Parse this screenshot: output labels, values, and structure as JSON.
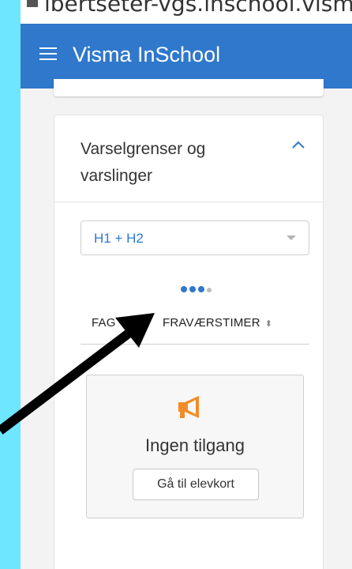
{
  "browser": {
    "url": "ibertseter-vgs.inschool.visma.no"
  },
  "appbar": {
    "title": "Visma InSchool"
  },
  "card": {
    "title": "Varselgrenser og varslinger",
    "select_value": "H1 + H2",
    "table": {
      "headers": [
        {
          "label": "FAG"
        },
        {
          "label": "FRAVÆRSTIMER"
        }
      ]
    },
    "empty": {
      "message": "Ingen tilgang",
      "button_label": "Gå til elevkort"
    }
  },
  "colors": {
    "primary": "#2f78cc",
    "accent": "#f28c28",
    "background": "#6ee6ff"
  }
}
